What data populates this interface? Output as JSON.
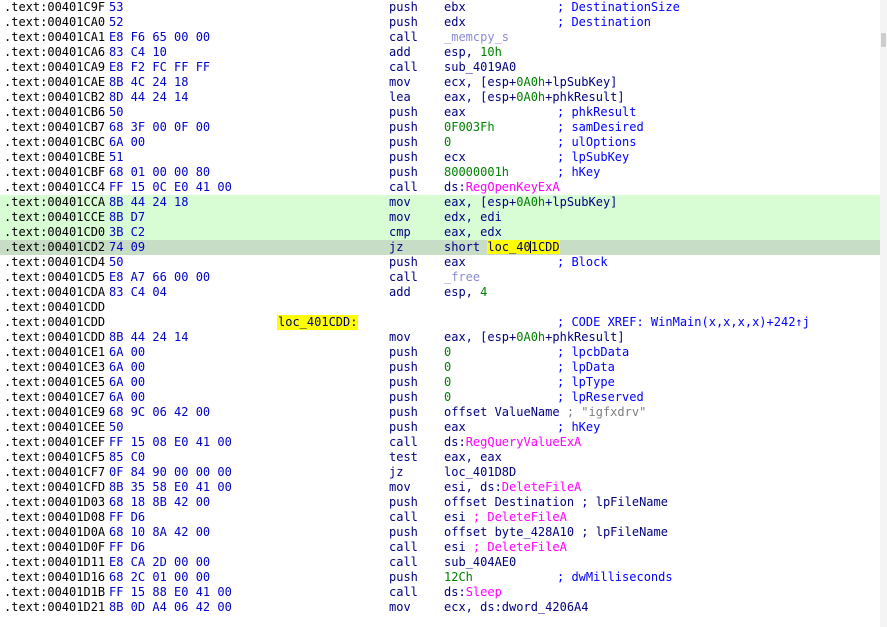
{
  "lines": [
    {
      "addr": ".text:00401C9F",
      "bytes": "53",
      "mnem": "push",
      "ops": [
        {
          "t": "ebx",
          "c": "r"
        }
      ],
      "comment": "; DestinationSize"
    },
    {
      "addr": ".text:00401CA0",
      "bytes": "52",
      "mnem": "push",
      "ops": [
        {
          "t": "edx",
          "c": "r"
        }
      ],
      "comment": "; Destination"
    },
    {
      "addr": ".text:00401CA1",
      "bytes": "E8 F6 65 00 00",
      "mnem": "call",
      "ops": [
        {
          "t": "_memcpy_s",
          "c": "lib"
        }
      ]
    },
    {
      "addr": ".text:00401CA6",
      "bytes": "83 C4 10",
      "mnem": "add",
      "ops": [
        {
          "t": "esp, ",
          "c": "r"
        },
        {
          "t": "10h",
          "c": "num"
        }
      ]
    },
    {
      "addr": ".text:00401CA9",
      "bytes": "E8 F2 FC FF FF",
      "mnem": "call",
      "ops": [
        {
          "t": "sub_4019A0",
          "c": "r"
        }
      ]
    },
    {
      "addr": ".text:00401CAE",
      "bytes": "8B 4C 24 18",
      "mnem": "mov",
      "ops": [
        {
          "t": "ecx, [esp+",
          "c": "r"
        },
        {
          "t": "0A0h",
          "c": "num"
        },
        {
          "t": "+lpSubKey]",
          "c": "r"
        }
      ]
    },
    {
      "addr": ".text:00401CB2",
      "bytes": "8D 44 24 14",
      "mnem": "lea",
      "ops": [
        {
          "t": "eax, [esp+",
          "c": "r"
        },
        {
          "t": "0A0h",
          "c": "num"
        },
        {
          "t": "+phkResult]",
          "c": "r"
        }
      ]
    },
    {
      "addr": ".text:00401CB6",
      "bytes": "50",
      "mnem": "push",
      "ops": [
        {
          "t": "eax",
          "c": "r"
        }
      ],
      "comment": "; phkResult"
    },
    {
      "addr": ".text:00401CB7",
      "bytes": "68 3F 00 0F 00",
      "mnem": "push",
      "ops": [
        {
          "t": "0F003Fh",
          "c": "num"
        }
      ],
      "comment": "; samDesired"
    },
    {
      "addr": ".text:00401CBC",
      "bytes": "6A 00",
      "mnem": "push",
      "ops": [
        {
          "t": "0",
          "c": "num"
        }
      ],
      "comment": "; ulOptions"
    },
    {
      "addr": ".text:00401CBE",
      "bytes": "51",
      "mnem": "push",
      "ops": [
        {
          "t": "ecx",
          "c": "r"
        }
      ],
      "comment": "; lpSubKey"
    },
    {
      "addr": ".text:00401CBF",
      "bytes": "68 01 00 00 80",
      "mnem": "push",
      "ops": [
        {
          "t": "80000001h",
          "c": "num"
        }
      ],
      "comment": "; hKey"
    },
    {
      "addr": ".text:00401CC4",
      "bytes": "FF 15 0C E0 41 00",
      "mnem": "call",
      "ops": [
        {
          "t": "ds:",
          "c": "r"
        },
        {
          "t": "RegOpenKeyExA",
          "c": "imp"
        }
      ]
    },
    {
      "addr": ".text:00401CCA",
      "bytes": "8B 44 24 18",
      "mnem": "mov",
      "ops": [
        {
          "t": "eax, [esp+",
          "c": "r"
        },
        {
          "t": "0A0h",
          "c": "num"
        },
        {
          "t": "+lpSubKey]",
          "c": "r"
        }
      ],
      "bg": "hl"
    },
    {
      "addr": ".text:00401CCE",
      "bytes": "8B D7",
      "mnem": "mov",
      "ops": [
        {
          "t": "edx, edi",
          "c": "r"
        }
      ],
      "bg": "hl"
    },
    {
      "addr": ".text:00401CD0",
      "bytes": "3B C2",
      "mnem": "cmp",
      "ops": [
        {
          "t": "eax, edx",
          "c": "r"
        }
      ],
      "bg": "hl"
    },
    {
      "addr": ".text:00401CD2",
      "bytes": "74 09",
      "mnem": "jz",
      "ops": [
        {
          "t": "short ",
          "c": "r"
        },
        {
          "t": "loc_401CDD",
          "c": "hlword"
        }
      ],
      "bg": "cur"
    },
    {
      "addr": ".text:00401CD4",
      "bytes": "50",
      "mnem": "push",
      "ops": [
        {
          "t": "eax",
          "c": "r"
        }
      ],
      "comment": "; Block"
    },
    {
      "addr": ".text:00401CD5",
      "bytes": "E8 A7 66 00 00",
      "mnem": "call",
      "ops": [
        {
          "t": "_free",
          "c": "lib"
        }
      ]
    },
    {
      "addr": ".text:00401CDA",
      "bytes": "83 C4 04",
      "mnem": "add",
      "ops": [
        {
          "t": "esp, ",
          "c": "r"
        },
        {
          "t": "4",
          "c": "num"
        }
      ]
    },
    {
      "addr": ".text:00401CDD"
    },
    {
      "addr": ".text:00401CDD",
      "label": "loc_401CDD:",
      "comment": "; CODE XREF: WinMain(x,x,x,x)+242↑j",
      "comment_class": "xref"
    },
    {
      "addr": ".text:00401CDD",
      "bytes": "8B 44 24 14",
      "mnem": "mov",
      "ops": [
        {
          "t": "eax, [esp+",
          "c": "r"
        },
        {
          "t": "0A0h",
          "c": "num"
        },
        {
          "t": "+phkResult]",
          "c": "r"
        }
      ]
    },
    {
      "addr": ".text:00401CE1",
      "bytes": "6A 00",
      "mnem": "push",
      "ops": [
        {
          "t": "0",
          "c": "num"
        }
      ],
      "comment": "; lpcbData"
    },
    {
      "addr": ".text:00401CE3",
      "bytes": "6A 00",
      "mnem": "push",
      "ops": [
        {
          "t": "0",
          "c": "num"
        }
      ],
      "comment": "; lpData"
    },
    {
      "addr": ".text:00401CE5",
      "bytes": "6A 00",
      "mnem": "push",
      "ops": [
        {
          "t": "0",
          "c": "num"
        }
      ],
      "comment": "; lpType"
    },
    {
      "addr": ".text:00401CE7",
      "bytes": "6A 00",
      "mnem": "push",
      "ops": [
        {
          "t": "0",
          "c": "num"
        }
      ],
      "comment": "; lpReserved"
    },
    {
      "addr": ".text:00401CE9",
      "bytes": "68 9C 06 42 00",
      "mnem": "push",
      "ops": [
        {
          "t": "offset ValueName ",
          "c": "r"
        },
        {
          "t": "; \"igfxdrv\"",
          "c": "str"
        }
      ]
    },
    {
      "addr": ".text:00401CEE",
      "bytes": "50",
      "mnem": "push",
      "ops": [
        {
          "t": "eax",
          "c": "r"
        }
      ],
      "comment": "; hKey"
    },
    {
      "addr": ".text:00401CEF",
      "bytes": "FF 15 08 E0 41 00",
      "mnem": "call",
      "ops": [
        {
          "t": "ds:",
          "c": "r"
        },
        {
          "t": "RegQueryValueExA",
          "c": "imp"
        }
      ]
    },
    {
      "addr": ".text:00401CF5",
      "bytes": "85 C0",
      "mnem": "test",
      "ops": [
        {
          "t": "eax, eax",
          "c": "r"
        }
      ]
    },
    {
      "addr": ".text:00401CF7",
      "bytes": "0F 84 90 00 00 00",
      "mnem": "jz",
      "ops": [
        {
          "t": "loc_401D8D",
          "c": "r"
        }
      ]
    },
    {
      "addr": ".text:00401CFD",
      "bytes": "8B 35 58 E0 41 00",
      "mnem": "mov",
      "ops": [
        {
          "t": "esi, ds:",
          "c": "r"
        },
        {
          "t": "DeleteFileA",
          "c": "imp"
        }
      ]
    },
    {
      "addr": ".text:00401D03",
      "bytes": "68 18 8B 42 00",
      "mnem": "push",
      "ops": [
        {
          "t": "offset Destination ; lpFileName",
          "c": "r"
        }
      ]
    },
    {
      "addr": ".text:00401D08",
      "bytes": "FF D6",
      "mnem": "call",
      "ops": [
        {
          "t": "esi ",
          "c": "r"
        },
        {
          "t": "; DeleteFileA",
          "c": "imp"
        }
      ]
    },
    {
      "addr": ".text:00401D0A",
      "bytes": "68 10 8A 42 00",
      "mnem": "push",
      "ops": [
        {
          "t": "offset byte_428A10 ; lpFileName",
          "c": "r"
        }
      ]
    },
    {
      "addr": ".text:00401D0F",
      "bytes": "FF D6",
      "mnem": "call",
      "ops": [
        {
          "t": "esi ",
          "c": "r"
        },
        {
          "t": "; DeleteFileA",
          "c": "imp"
        }
      ]
    },
    {
      "addr": ".text:00401D11",
      "bytes": "E8 CA 2D 00 00",
      "mnem": "call",
      "ops": [
        {
          "t": "sub_404AE0",
          "c": "r"
        }
      ]
    },
    {
      "addr": ".text:00401D16",
      "bytes": "68 2C 01 00 00",
      "mnem": "push",
      "ops": [
        {
          "t": "12Ch",
          "c": "num"
        }
      ],
      "comment": "; dwMilliseconds"
    },
    {
      "addr": ".text:00401D1B",
      "bytes": "FF 15 88 E0 41 00",
      "mnem": "call",
      "ops": [
        {
          "t": "ds:",
          "c": "r"
        },
        {
          "t": "Sleep",
          "c": "imp"
        }
      ]
    },
    {
      "addr": ".text:00401D21",
      "bytes": "8B 0D A4 06 42 00",
      "mnem": "mov",
      "ops": [
        {
          "t": "ecx, ds:dword_4206A4",
          "c": "r"
        }
      ]
    }
  ]
}
